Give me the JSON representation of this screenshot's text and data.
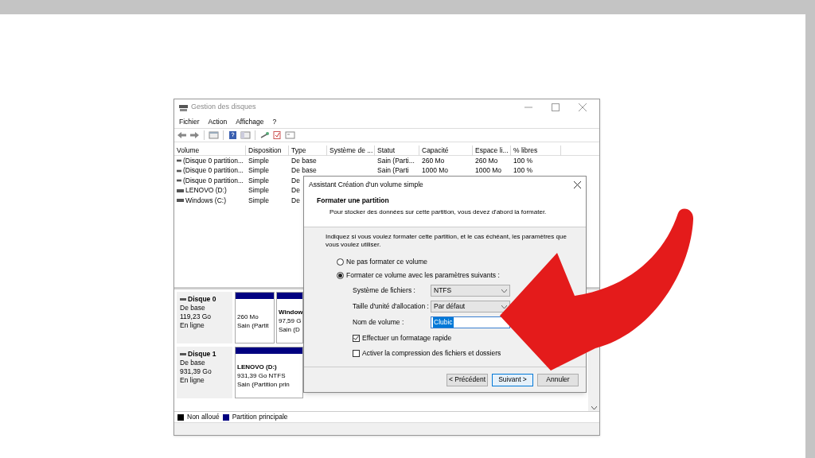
{
  "window": {
    "title": "Gestion des disques"
  },
  "menu": [
    "Fichier",
    "Action",
    "Affichage",
    "?"
  ],
  "volume_table": {
    "columns": [
      "Volume",
      "Disposition",
      "Type",
      "Système de ...",
      "Statut",
      "Capacité",
      "Espace li...",
      "% libres"
    ],
    "rows": [
      [
        "(Disque 0 partition...",
        "Simple",
        "De base",
        "",
        "Sain (Parti...",
        "260 Mo",
        "260 Mo",
        "100 %"
      ],
      [
        "(Disque 0 partition...",
        "Simple",
        "De base",
        "",
        "Sain (Parti",
        "1000 Mo",
        "1000 Mo",
        "100 %"
      ],
      [
        "(Disque 0 partition...",
        "Simple",
        "De"
      ],
      [
        "LENOVO (D:)",
        "Simple",
        "De"
      ],
      [
        "Windows (C:)",
        "Simple",
        "De"
      ]
    ]
  },
  "disks": [
    {
      "name": "Disque 0",
      "type": "De base",
      "size": "119,23 Go",
      "state": "En ligne",
      "partitions": [
        {
          "lines": [
            "260 Mo",
            "Sain (Partit"
          ]
        },
        {
          "name": "Window",
          "lines": [
            "97,59 G",
            "Sain (D"
          ]
        }
      ]
    },
    {
      "name": "Disque 1",
      "type": "De base",
      "size": "931,39 Go",
      "state": "En ligne",
      "partitions": [
        {
          "name": "LENOVO  (D:)",
          "lines": [
            "931,39 Go NTFS",
            "Sain (Partition prin"
          ]
        }
      ]
    }
  ],
  "legend": [
    {
      "label": "Non alloué",
      "color": "#000000"
    },
    {
      "label": "Partition principale",
      "color": "#000080"
    }
  ],
  "dialog": {
    "title": "Assistant Création d'un volume simple",
    "heading": "Formater une partition",
    "subheading": "Pour stocker des données sur cette partition, vous devez d'abord la formater.",
    "intro": "Indiquez si vous voulez formater cette partition, et le cas échéant, les paramètres que vous voulez utiliser.",
    "radios": [
      {
        "label": "Ne pas formater ce volume",
        "selected": false
      },
      {
        "label": "Formater ce volume avec les paramètres suivants :",
        "selected": true
      }
    ],
    "fields": [
      {
        "kind": "select",
        "label": "Système de fichiers :",
        "value": "NTFS"
      },
      {
        "kind": "select",
        "label": "Taille d'unité d'allocation :",
        "value": "Par défaut"
      },
      {
        "kind": "text",
        "label": "Nom de volume :",
        "value": "Clubic"
      }
    ],
    "checkboxes": [
      {
        "label": "Effectuer un formatage rapide",
        "checked": true
      },
      {
        "label": "Activer la compression des fichiers et dossiers",
        "checked": false
      }
    ],
    "buttons": [
      {
        "label": "< Précédent",
        "default": false
      },
      {
        "label": "Suivant >",
        "default": true
      },
      {
        "label": "Annuler",
        "default": false
      }
    ]
  }
}
